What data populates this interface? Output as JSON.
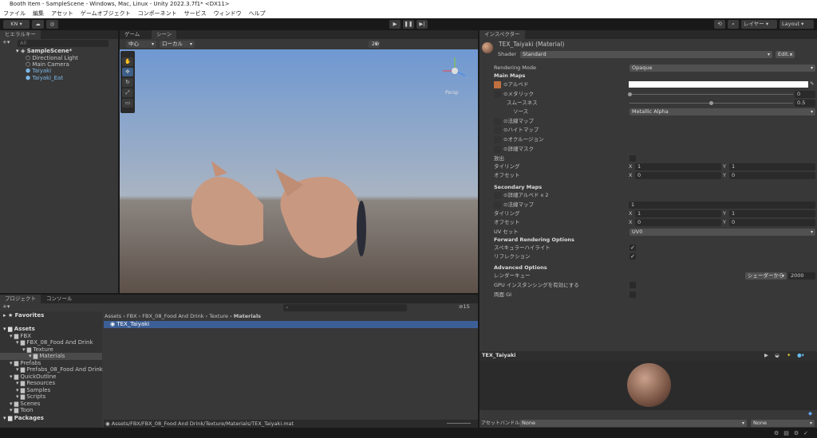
{
  "window": {
    "title": "Booth Item - SampleScene - Windows, Mac, Linux - Unity 2022.3.7f1* <DX11>"
  },
  "menu": [
    "ファイル",
    "編集",
    "アセット",
    "ゲームオブジェクト",
    "コンポーネント",
    "サービス",
    "ウィンドウ",
    "ヘルプ"
  ],
  "toolbar": {
    "account": "KN ▾",
    "layers": "レイヤー",
    "layout": "Layout"
  },
  "hierarchy": {
    "tab": "ヒエラルキー",
    "search_placeholder": "All",
    "scene": "SampleScene*",
    "items": [
      "Directional Light",
      "Main Camera",
      "Taiyaki",
      "Taiyaki_Eat"
    ]
  },
  "scene": {
    "tabs": [
      "ゲーム",
      "シーン"
    ],
    "pivot": "中心",
    "space": "ローカル",
    "mode2d": "2D",
    "persp": "Persp"
  },
  "inspector": {
    "tab": "インスペクター",
    "material": "TEX_Taiyaki (Material)",
    "shader_label": "Shader",
    "shader": "Standard",
    "edit": "Edit...",
    "rendering_mode_label": "Rendering Mode",
    "rendering_mode": "Opaque",
    "main_maps": "Main Maps",
    "albedo": "アルベド",
    "metallic": "メタリック",
    "metallic_value": "0",
    "metallic_fraction": 0,
    "smoothness": "スムースネス",
    "smoothness_value": "0.5",
    "smoothness_fraction": 0.5,
    "source_label": "ソース",
    "source": "Metallic Alpha",
    "normal_map": "法線マップ",
    "height_map": "ハイトマップ",
    "occlusion": "オクルージョン",
    "detail_mask": "詳細マスク",
    "emission": "放出",
    "tiling": "タイリング",
    "offset": "オフセット",
    "tiling_x": "1",
    "tiling_y": "1",
    "offset_x": "0",
    "offset_y": "0",
    "secondary_maps": "Secondary Maps",
    "detail_albedo": "詳細アルベド x 2",
    "detail_normal": "法線マップ",
    "detail_normal_value": "1",
    "sec_tiling_x": "1",
    "sec_tiling_y": "1",
    "sec_offset_x": "0",
    "sec_offset_y": "0",
    "uv_set_label": "UV セット",
    "uv_set": "UV0",
    "forward": "Forward Rendering Options",
    "specular": "スペキュラーハイライト",
    "reflections": "リフレクション",
    "advanced": "Advanced Options",
    "render_queue": "レンダーキュー",
    "render_queue_mode": "シェーダーから",
    "render_queue_value": "2000",
    "gpu_instancing": "GPU インスタンシングを有効にする",
    "double_gi": "両面 GI",
    "preview_title": "TEX_Taiyaki",
    "asset_bundle_label": "アセットバンドル",
    "asset_bundle": "None",
    "asset_variant": "None",
    "x": "X",
    "y": "Y"
  },
  "project": {
    "tabs": [
      "プロジェクト",
      "コンソール"
    ],
    "hidden_count": "15",
    "favorites": "Favorites",
    "tree": [
      {
        "label": "Assets",
        "d": 0,
        "bold": true
      },
      {
        "label": "FBX",
        "d": 1
      },
      {
        "label": "FBX_08_Food And Drink",
        "d": 2
      },
      {
        "label": "Texture",
        "d": 3
      },
      {
        "label": "Materials",
        "d": 4,
        "sel": true
      },
      {
        "label": "Prefabs",
        "d": 1
      },
      {
        "label": "Prefabs_08_Food And Drink",
        "d": 2
      },
      {
        "label": "QuickOutline",
        "d": 1
      },
      {
        "label": "Resources",
        "d": 2
      },
      {
        "label": "Samples",
        "d": 2
      },
      {
        "label": "Scripts",
        "d": 2
      },
      {
        "label": "Scenes",
        "d": 1
      },
      {
        "label": "Toon",
        "d": 1
      },
      {
        "label": "Packages",
        "d": 0,
        "bold": true
      }
    ],
    "breadcrumb": [
      "Assets",
      "FBX",
      "FBX_08_Food And Drink",
      "Texture",
      "Materials"
    ],
    "files": [
      "TEX_Taiyaki"
    ],
    "path": "Assets/FBX/FBX_08_Food And Drink/Texture/Materials/TEX_Taiyaki.mat"
  }
}
